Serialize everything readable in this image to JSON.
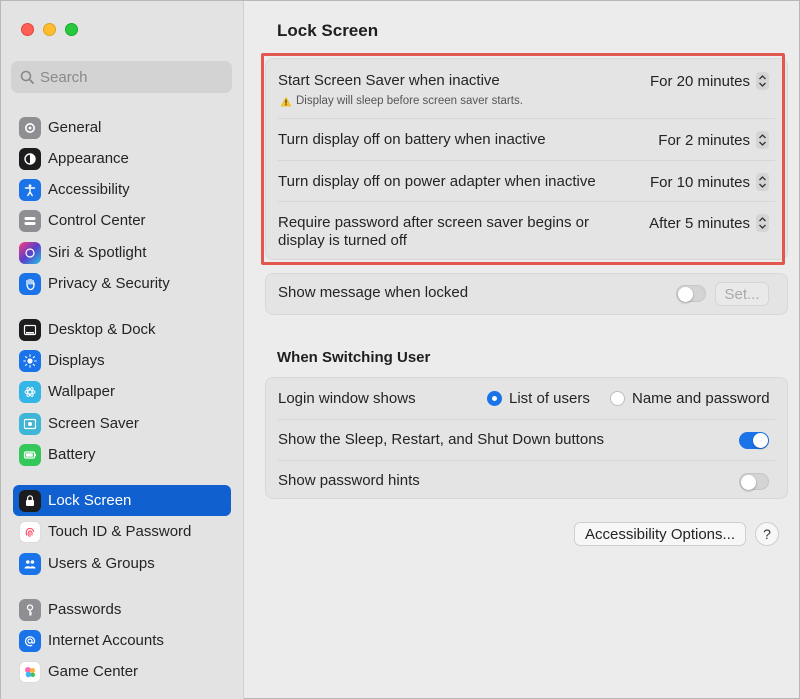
{
  "sidebar": {
    "search_placeholder": "Search",
    "items": [
      {
        "label": "General",
        "icon": "gear-icon",
        "color": "#8e8e93"
      },
      {
        "label": "Appearance",
        "icon": "appearance-icon",
        "color": "#1c1c1e"
      },
      {
        "label": "Accessibility",
        "icon": "accessibility-icon",
        "color": "#1a73e8"
      },
      {
        "label": "Control Center",
        "icon": "control-center-icon",
        "color": "#8e8e93"
      },
      {
        "label": "Siri & Spotlight",
        "icon": "siri-icon",
        "color": "#5a3ec8"
      },
      {
        "label": "Privacy & Security",
        "icon": "hand-icon",
        "color": "#1a73e8"
      },
      {
        "label": "Desktop & Dock",
        "icon": "dock-icon",
        "color": "#1c1c1e"
      },
      {
        "label": "Displays",
        "icon": "sun-icon",
        "color": "#1a73e8"
      },
      {
        "label": "Wallpaper",
        "icon": "wallpaper-icon",
        "color": "#33b5e5"
      },
      {
        "label": "Screen Saver",
        "icon": "screen-saver-icon",
        "color": "#3fb6d8"
      },
      {
        "label": "Battery",
        "icon": "battery-icon",
        "color": "#34c759"
      },
      {
        "label": "Lock Screen",
        "icon": "lock-icon",
        "color": "#1c1c1e",
        "selected": true
      },
      {
        "label": "Touch ID & Password",
        "icon": "fingerprint-icon",
        "color": "#ffffff"
      },
      {
        "label": "Users & Groups",
        "icon": "users-icon",
        "color": "#1a73e8"
      },
      {
        "label": "Passwords",
        "icon": "key-icon",
        "color": "#8e8e93"
      },
      {
        "label": "Internet Accounts",
        "icon": "at-icon",
        "color": "#1a73e8"
      },
      {
        "label": "Game Center",
        "icon": "game-center-icon",
        "color": "#ff6bb0"
      }
    ]
  },
  "main": {
    "title": "Lock Screen",
    "rows": [
      {
        "label": "Start Screen Saver when inactive",
        "value": "For 20 minutes",
        "warning": "Display will sleep before screen saver starts."
      },
      {
        "label": "Turn display off on battery when inactive",
        "value": "For 2 minutes"
      },
      {
        "label": "Turn display off on power adapter when inactive",
        "value": "For 10 minutes"
      },
      {
        "label_line1": "Require password after screen saver begins or",
        "label_line2": "display is turned off",
        "value": "After 5 minutes"
      }
    ],
    "show_message": {
      "label": "Show message when locked",
      "toggle": false,
      "set_button": "Set..."
    },
    "switching_title": "When Switching User",
    "login_window": {
      "label": "Login window shows",
      "options": [
        "List of users",
        "Name and password"
      ],
      "selected": "List of users"
    },
    "sleep_buttons": {
      "label": "Show the Sleep, Restart, and Shut Down buttons",
      "toggle": true
    },
    "password_hints": {
      "label": "Show password hints",
      "toggle": false
    },
    "accessibility_button": "Accessibility Options...",
    "help_label": "?"
  },
  "colors": {
    "accent": "#1a73e8",
    "highlight_border": "#e2584e",
    "selection": "#1060d0"
  }
}
